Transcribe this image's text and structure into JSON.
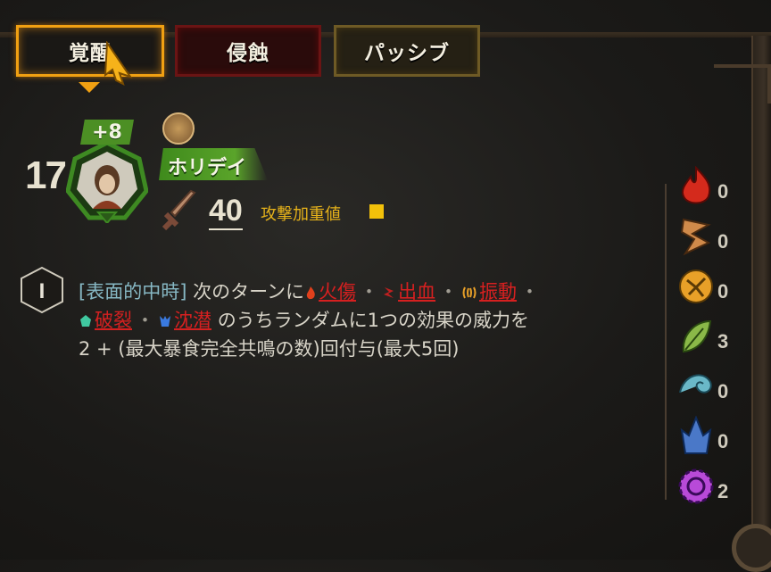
{
  "tabs": [
    {
      "label": "覚醒"
    },
    {
      "label": "侵蝕"
    },
    {
      "label": "パッシブ"
    }
  ],
  "character": {
    "level": "17",
    "plus": "+8",
    "name": "ホリデイ",
    "attack_value": "40",
    "attack_label": "攻撃加重値",
    "attack_color": "#f2c10a"
  },
  "skill": {
    "index": "I",
    "tag": "[表面的中時]",
    "prefix": "次のターンに",
    "effects": [
      {
        "name": "火傷",
        "color": "#d62020"
      },
      {
        "name": "出血",
        "color": "#d62020"
      },
      {
        "name": "振動",
        "color": "#d62020"
      },
      {
        "name": "破裂",
        "color": "#d62020"
      },
      {
        "name": "沈潜",
        "color": "#d62020"
      }
    ],
    "separator": "・",
    "suffix": "のうちランダムに1つの効果の威力を",
    "line3": "2 + (最大暴食完全共鳴の数)回付与(最大5回)"
  },
  "statuses": [
    {
      "icon": "flame-icon",
      "count": "0",
      "color": "#d42a1c"
    },
    {
      "icon": "bleed-icon",
      "count": "0",
      "color": "#d08a4a"
    },
    {
      "icon": "tremor-icon",
      "count": "0",
      "color": "#e8a028"
    },
    {
      "icon": "leaf-icon",
      "count": "3",
      "color": "#8ab848"
    },
    {
      "icon": "wave-icon",
      "count": "0",
      "color": "#6ab8c8"
    },
    {
      "icon": "crystal-icon",
      "count": "0",
      "color": "#4a78c8"
    },
    {
      "icon": "gear-icon",
      "count": "2",
      "color": "#b84ad8"
    }
  ]
}
